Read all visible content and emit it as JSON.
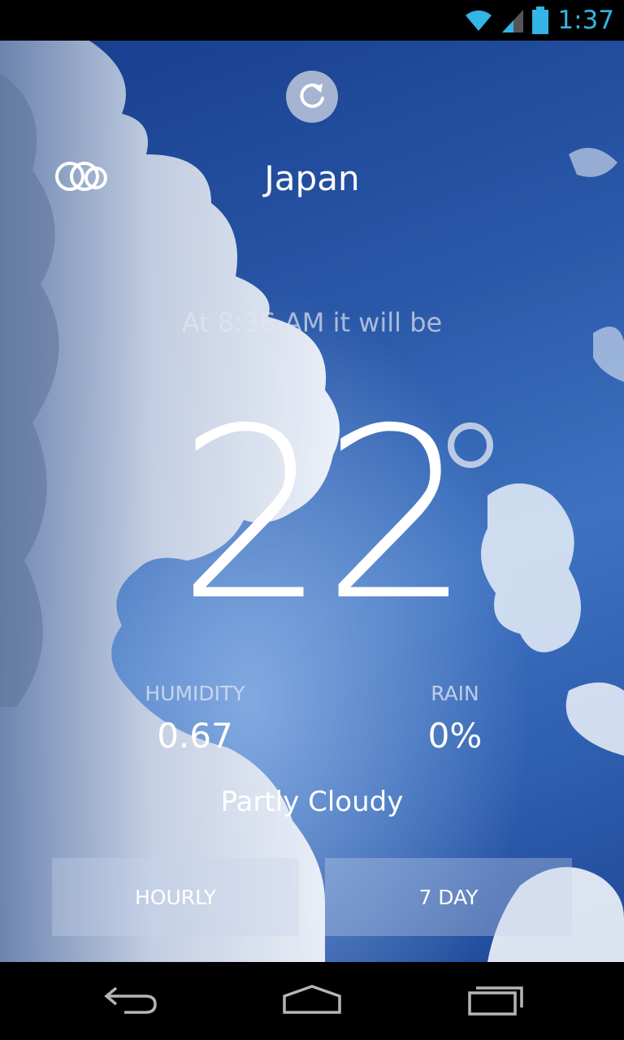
{
  "status_bar": {
    "time": "1:37",
    "wifi_icon": "wifi-icon",
    "signal_icon": "signal-icon",
    "battery_icon": "battery-icon",
    "accent_color": "#33b5e5"
  },
  "weather": {
    "location": "Japan",
    "forecast_time_text": "At 8:36 AM it will be",
    "temperature": "22",
    "degree_icon": "degree-icon",
    "humidity_label": "HUMIDITY",
    "humidity_value": "0.67",
    "rain_label": "RAIN",
    "rain_value": "0%",
    "condition": "Partly Cloudy",
    "condition_icon": "cloud-icon",
    "refresh_icon": "refresh-icon"
  },
  "tabs": {
    "hourly_label": "HOURLY",
    "seven_day_label": "7 DAY"
  },
  "nav_bar": {
    "back_icon": "back-icon",
    "home_icon": "home-icon",
    "recents_icon": "recents-icon"
  }
}
